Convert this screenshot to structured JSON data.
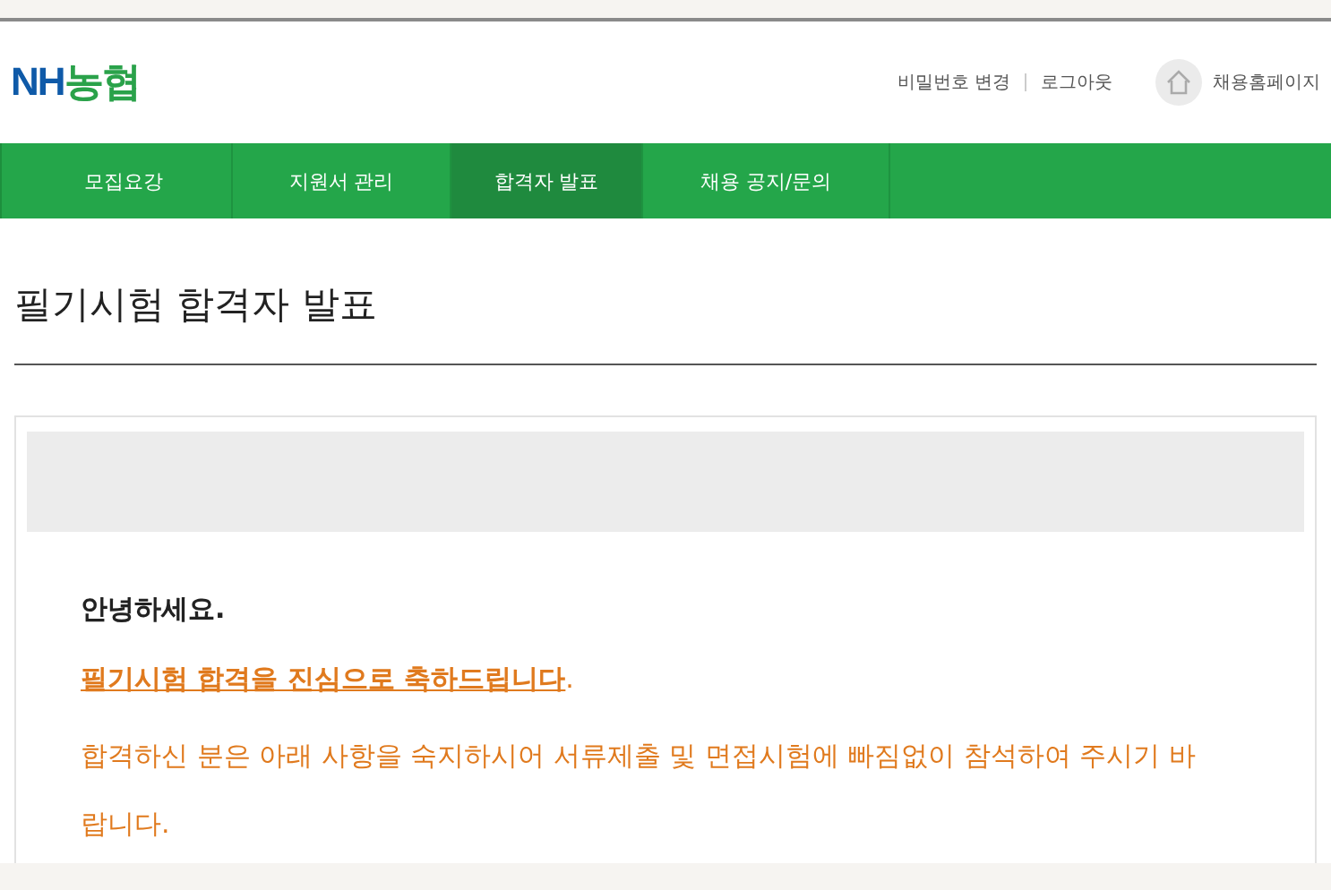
{
  "header": {
    "logo": {
      "latin": "NH",
      "hangul": "농협"
    },
    "links": [
      "비밀번호 변경",
      "로그아웃"
    ],
    "home_link": "채용홈페이지"
  },
  "nav": [
    {
      "label": "모집요강",
      "selected": false
    },
    {
      "label": "지원서 관리",
      "selected": false
    },
    {
      "label": "합격자 발표",
      "selected": true
    },
    {
      "label": "채용 공지/문의",
      "selected": false
    }
  ],
  "page_title": "필기시험 합격자 발표",
  "message": {
    "greeting": "안녕하세요.",
    "congrats": "**필기시험 합격을 진심으로 축하드립니다**.",
    "body": "합격하신 분은 아래 사항을 숙지하시어 서류제출 및 면접시험에 빠짐없이 참석하여 주시기 바랍니다."
  }
}
